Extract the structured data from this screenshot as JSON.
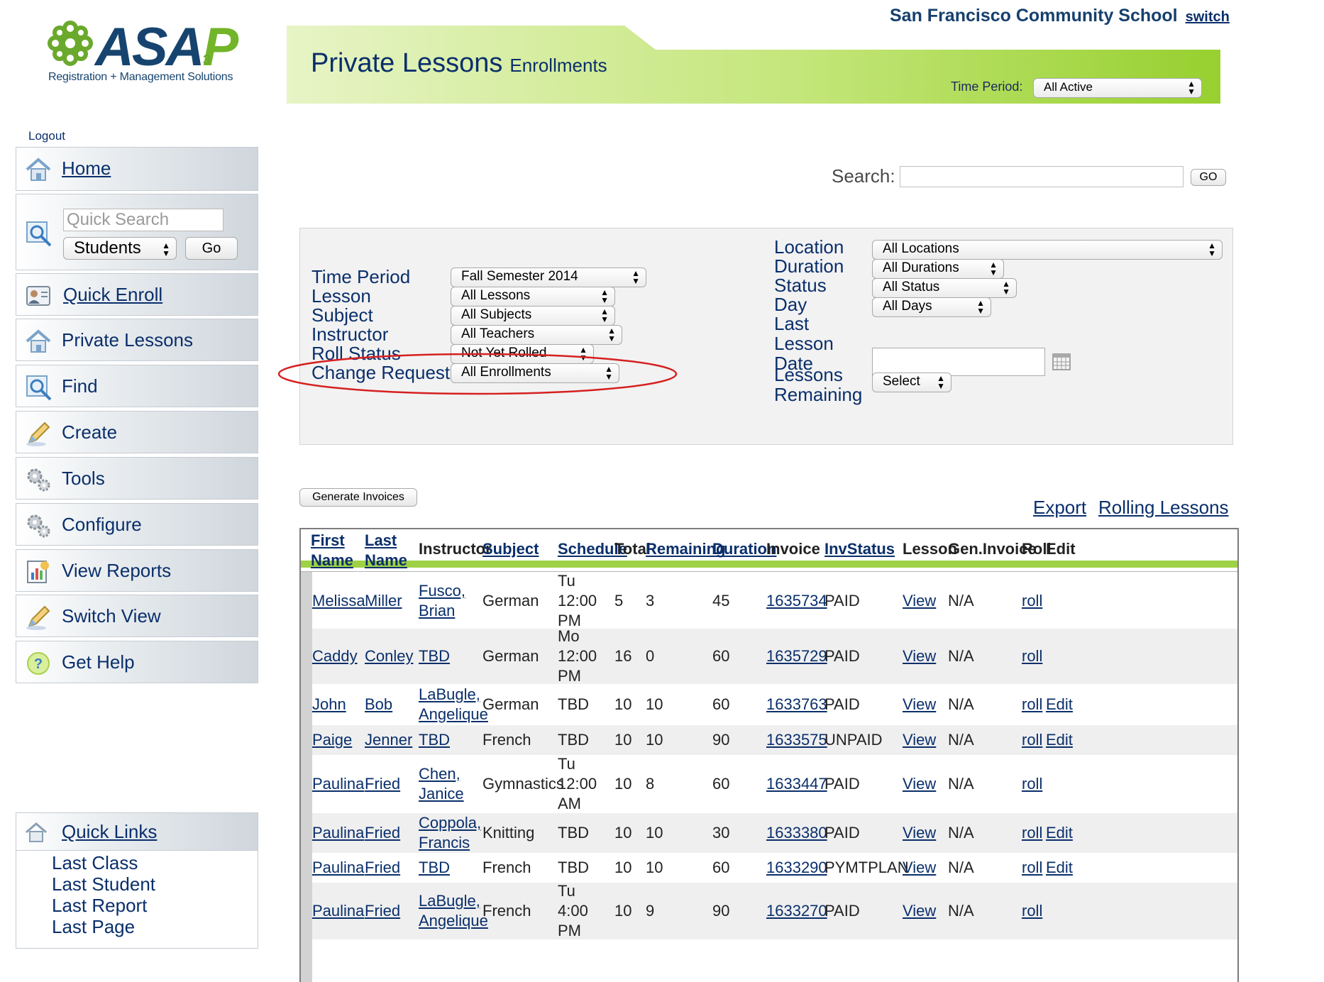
{
  "brand": {
    "logo_word": "ASA",
    "logo_p": "P",
    "logo_sup": "3",
    "tagline": "Registration + Management Solutions",
    "primary_color": "#17446f",
    "accent_green": "#72b52a"
  },
  "school": {
    "name": "San Francisco Community School",
    "switch_label": "switch"
  },
  "header": {
    "title": "Private Lessons",
    "subtitle": "Enrollments",
    "time_period_label": "Time Period:",
    "time_period_value": "All Active"
  },
  "sidebar": {
    "logout": "Logout",
    "home": "Home",
    "quick_search_placeholder": "Quick Search",
    "quick_search_scope": "Students",
    "quick_search_go": "Go",
    "items": [
      {
        "label": "Quick Enroll",
        "icon": "person-card-icon"
      },
      {
        "label": "Private Lessons",
        "icon": "house-icon"
      },
      {
        "label": "Find",
        "icon": "magnifier-icon"
      },
      {
        "label": "Create",
        "icon": "pencil-icon"
      },
      {
        "label": "Tools",
        "icon": "gears-icon"
      },
      {
        "label": "Configure",
        "icon": "gears-icon"
      },
      {
        "label": "View Reports",
        "icon": "report-icon"
      },
      {
        "label": "Switch View",
        "icon": "pencil-icon"
      },
      {
        "label": "Get Help",
        "icon": "help-icon"
      }
    ],
    "quick_links": {
      "title": "Quick Links",
      "links": [
        "Last Class",
        "Last Student",
        "Last Report",
        "Last Page"
      ]
    }
  },
  "search": {
    "label": "Search:",
    "go": "GO",
    "value": ""
  },
  "filters": {
    "left": [
      {
        "label": "Time Period",
        "value": "Fall Semester 2014"
      },
      {
        "label": "Lesson",
        "value": "All Lessons"
      },
      {
        "label": "Subject",
        "value": "All Subjects"
      },
      {
        "label": "Instructor",
        "value": "All Teachers"
      },
      {
        "label": "Roll Status",
        "value": "Not Yet Rolled"
      },
      {
        "label": "Change Request",
        "value": "All Enrollments"
      }
    ],
    "right": [
      {
        "label": "Location",
        "value": "All Locations"
      },
      {
        "label": "Duration",
        "value": "All Durations"
      },
      {
        "label": "Status",
        "value": "All Status"
      },
      {
        "label": "Day",
        "value": "All Days"
      },
      {
        "label": "Last Lesson Date",
        "value": ""
      },
      {
        "label": "Lessons Remaining",
        "value": "Select"
      }
    ],
    "highlight_color": "#d62020"
  },
  "actions": {
    "generate_invoices": "Generate Invoices",
    "export": "Export",
    "rolling_lessons": "Rolling Lessons"
  },
  "table": {
    "columns": [
      "First Name",
      "Last Name",
      "Instructor",
      "Subject",
      "Schedule",
      "Total",
      "Remaining",
      "Duration",
      "Invoice",
      "InvStatus",
      "Lesson",
      "Gen.Invoice",
      "Roll",
      "Edit"
    ],
    "rows": [
      {
        "first": "Melissa",
        "last": "Miller",
        "instructor": "Fusco, Brian",
        "subject": "German",
        "schedule": "Tu 12:00 PM",
        "total": "5",
        "remaining": "3",
        "duration": "45",
        "invoice": "1635734",
        "inv_status": "PAID",
        "lesson": "View",
        "gen_invoice": "N/A",
        "roll": "roll",
        "edit": ""
      },
      {
        "first": "Caddy",
        "last": "Conley",
        "instructor": "TBD",
        "subject": "German",
        "schedule": "Mo 12:00 PM",
        "total": "16",
        "remaining": "0",
        "duration": "60",
        "invoice": "1635729",
        "inv_status": "PAID",
        "lesson": "View",
        "gen_invoice": "N/A",
        "roll": "roll",
        "edit": ""
      },
      {
        "first": "John",
        "last": "Bob",
        "instructor": "LaBugle, Angelique",
        "subject": "German",
        "schedule": "TBD",
        "total": "10",
        "remaining": "10",
        "duration": "60",
        "invoice": "1633763",
        "inv_status": "PAID",
        "lesson": "View",
        "gen_invoice": "N/A",
        "roll": "roll",
        "edit": "Edit"
      },
      {
        "first": "Paige",
        "last": "Jenner",
        "instructor": "TBD",
        "subject": "French",
        "schedule": "TBD",
        "total": "10",
        "remaining": "10",
        "duration": "90",
        "invoice": "1633575",
        "inv_status": "UNPAID",
        "lesson": "View",
        "gen_invoice": "N/A",
        "roll": "roll",
        "edit": "Edit"
      },
      {
        "first": "Paulina",
        "last": "Fried",
        "instructor": "Chen, Janice",
        "subject": "Gymnastics",
        "schedule": "Tu 12:00 AM",
        "total": "10",
        "remaining": "8",
        "duration": "60",
        "invoice": "1633447",
        "inv_status": "PAID",
        "lesson": "View",
        "gen_invoice": "N/A",
        "roll": "roll",
        "edit": ""
      },
      {
        "first": "Paulina",
        "last": "Fried",
        "instructor": "Coppola, Francis",
        "subject": "Knitting",
        "schedule": "TBD",
        "total": "10",
        "remaining": "10",
        "duration": "30",
        "invoice": "1633380",
        "inv_status": "PAID",
        "lesson": "View",
        "gen_invoice": "N/A",
        "roll": "roll",
        "edit": "Edit"
      },
      {
        "first": "Paulina",
        "last": "Fried",
        "instructor": "TBD",
        "subject": "French",
        "schedule": "TBD",
        "total": "10",
        "remaining": "10",
        "duration": "60",
        "invoice": "1633290",
        "inv_status": "PYMTPLAN",
        "lesson": "View",
        "gen_invoice": "N/A",
        "roll": "roll",
        "edit": "Edit"
      },
      {
        "first": "Paulina",
        "last": "Fried",
        "instructor": "LaBugle, Angelique",
        "subject": "French",
        "schedule": "Tu 4:00 PM",
        "total": "10",
        "remaining": "9",
        "duration": "90",
        "invoice": "1633270",
        "inv_status": "PAID",
        "lesson": "View",
        "gen_invoice": "N/A",
        "roll": "roll",
        "edit": ""
      }
    ]
  }
}
